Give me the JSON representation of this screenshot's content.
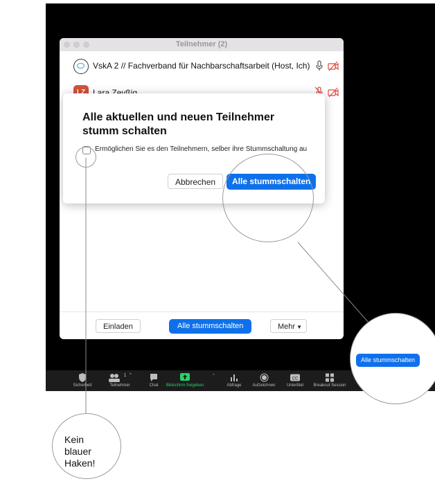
{
  "window": {
    "title": "Teilnehmer (2)"
  },
  "participants": [
    {
      "name": "VskA 2 // Fachverband für Nachbarschaftsarbeit (Host, Ich)",
      "avatar": "vska-logo-icon",
      "mic_muted": false,
      "video_off": true
    },
    {
      "name": "Lara Zeyßig",
      "initials": "LZ",
      "mic_muted": true,
      "video_off": true
    }
  ],
  "dialog": {
    "heading": "Alle aktuellen und neuen Teilnehmer stumm schalten",
    "checkbox_label": "Ermöglichen Sie es den Teilnehmern, selber ihre Stummschaltung au",
    "checkbox_checked": false,
    "cancel_label": "Abbrechen",
    "confirm_label": "Alle stummschalten"
  },
  "footer": {
    "invite_label": "Einladen",
    "mute_all_label": "Alle stummschalten",
    "more_label": "Mehr"
  },
  "zoom_callout": {
    "button_label": "Alle stummschalten"
  },
  "toolbar": {
    "items": [
      {
        "label": "Sicherheit",
        "icon": "shield-icon"
      },
      {
        "label": "Teilnehmer",
        "icon": "participants-icon",
        "count": "1"
      },
      {
        "label": "Chat",
        "icon": "chat-icon"
      },
      {
        "label": "Bildschirm freigeben",
        "icon": "share-screen-icon"
      },
      {
        "label": "Abfrage",
        "icon": "poll-icon"
      },
      {
        "label": "Aufzeichnen",
        "icon": "record-icon"
      },
      {
        "label": "Untertitel",
        "icon": "cc-icon"
      },
      {
        "label": "Breakout Session",
        "icon": "breakout-icon"
      }
    ]
  },
  "annotation": {
    "lines": [
      "Kein",
      "blauer",
      "Haken!"
    ]
  },
  "colors": {
    "accent_blue": "#0e71eb",
    "share_green": "#25d366",
    "muted_red": "#e0473a",
    "background_black": "#000000"
  }
}
